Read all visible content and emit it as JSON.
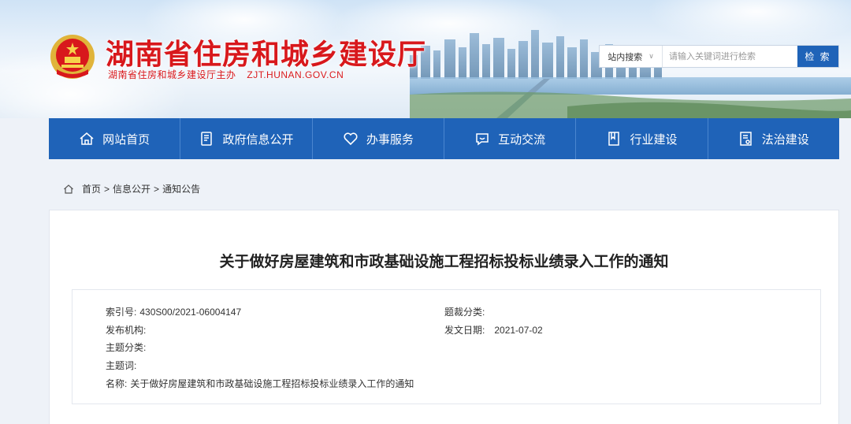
{
  "header": {
    "title": "湖南省住房和城乡建设厅",
    "subtitle": "湖南省住房和城乡建设厅主办",
    "domain": "ZJT.HUNAN.GOV.CN"
  },
  "search": {
    "scope": "站内搜索",
    "placeholder": "请输入关键词进行检索",
    "button": "检 索"
  },
  "nav": {
    "items": [
      {
        "label": "网站首页",
        "icon": "home-icon"
      },
      {
        "label": "政府信息公开",
        "icon": "document-icon"
      },
      {
        "label": "办事服务",
        "icon": "heart-icon"
      },
      {
        "label": "互动交流",
        "icon": "chat-icon"
      },
      {
        "label": "行业建设",
        "icon": "book-icon"
      },
      {
        "label": "法治建设",
        "icon": "law-icon"
      }
    ]
  },
  "breadcrumb": {
    "items": [
      "首页",
      "信息公开",
      "通知公告"
    ],
    "separator": ">"
  },
  "article": {
    "title": "关于做好房屋建筑和市政基础设施工程招标投标业绩录入工作的通知",
    "meta": {
      "index_label": "索引号:",
      "index_value": "430S00/2021-06004147",
      "publisher_label": "发布机构:",
      "publisher_value": "",
      "topic_label": "主题分类:",
      "topic_value": "",
      "keywords_label": "主题词:",
      "keywords_value": "",
      "name_label": "名称:",
      "name_value": "关于做好房屋建筑和市政基础设施工程招标投标业绩录入工作的通知",
      "genre_label": "题裁分类:",
      "genre_value": "",
      "date_label": "发文日期:",
      "date_value": "2021-07-02"
    }
  },
  "colors": {
    "nav_bg": "#1f63b8",
    "title_red": "#d8181c",
    "search_btn": "#1f63b8"
  }
}
